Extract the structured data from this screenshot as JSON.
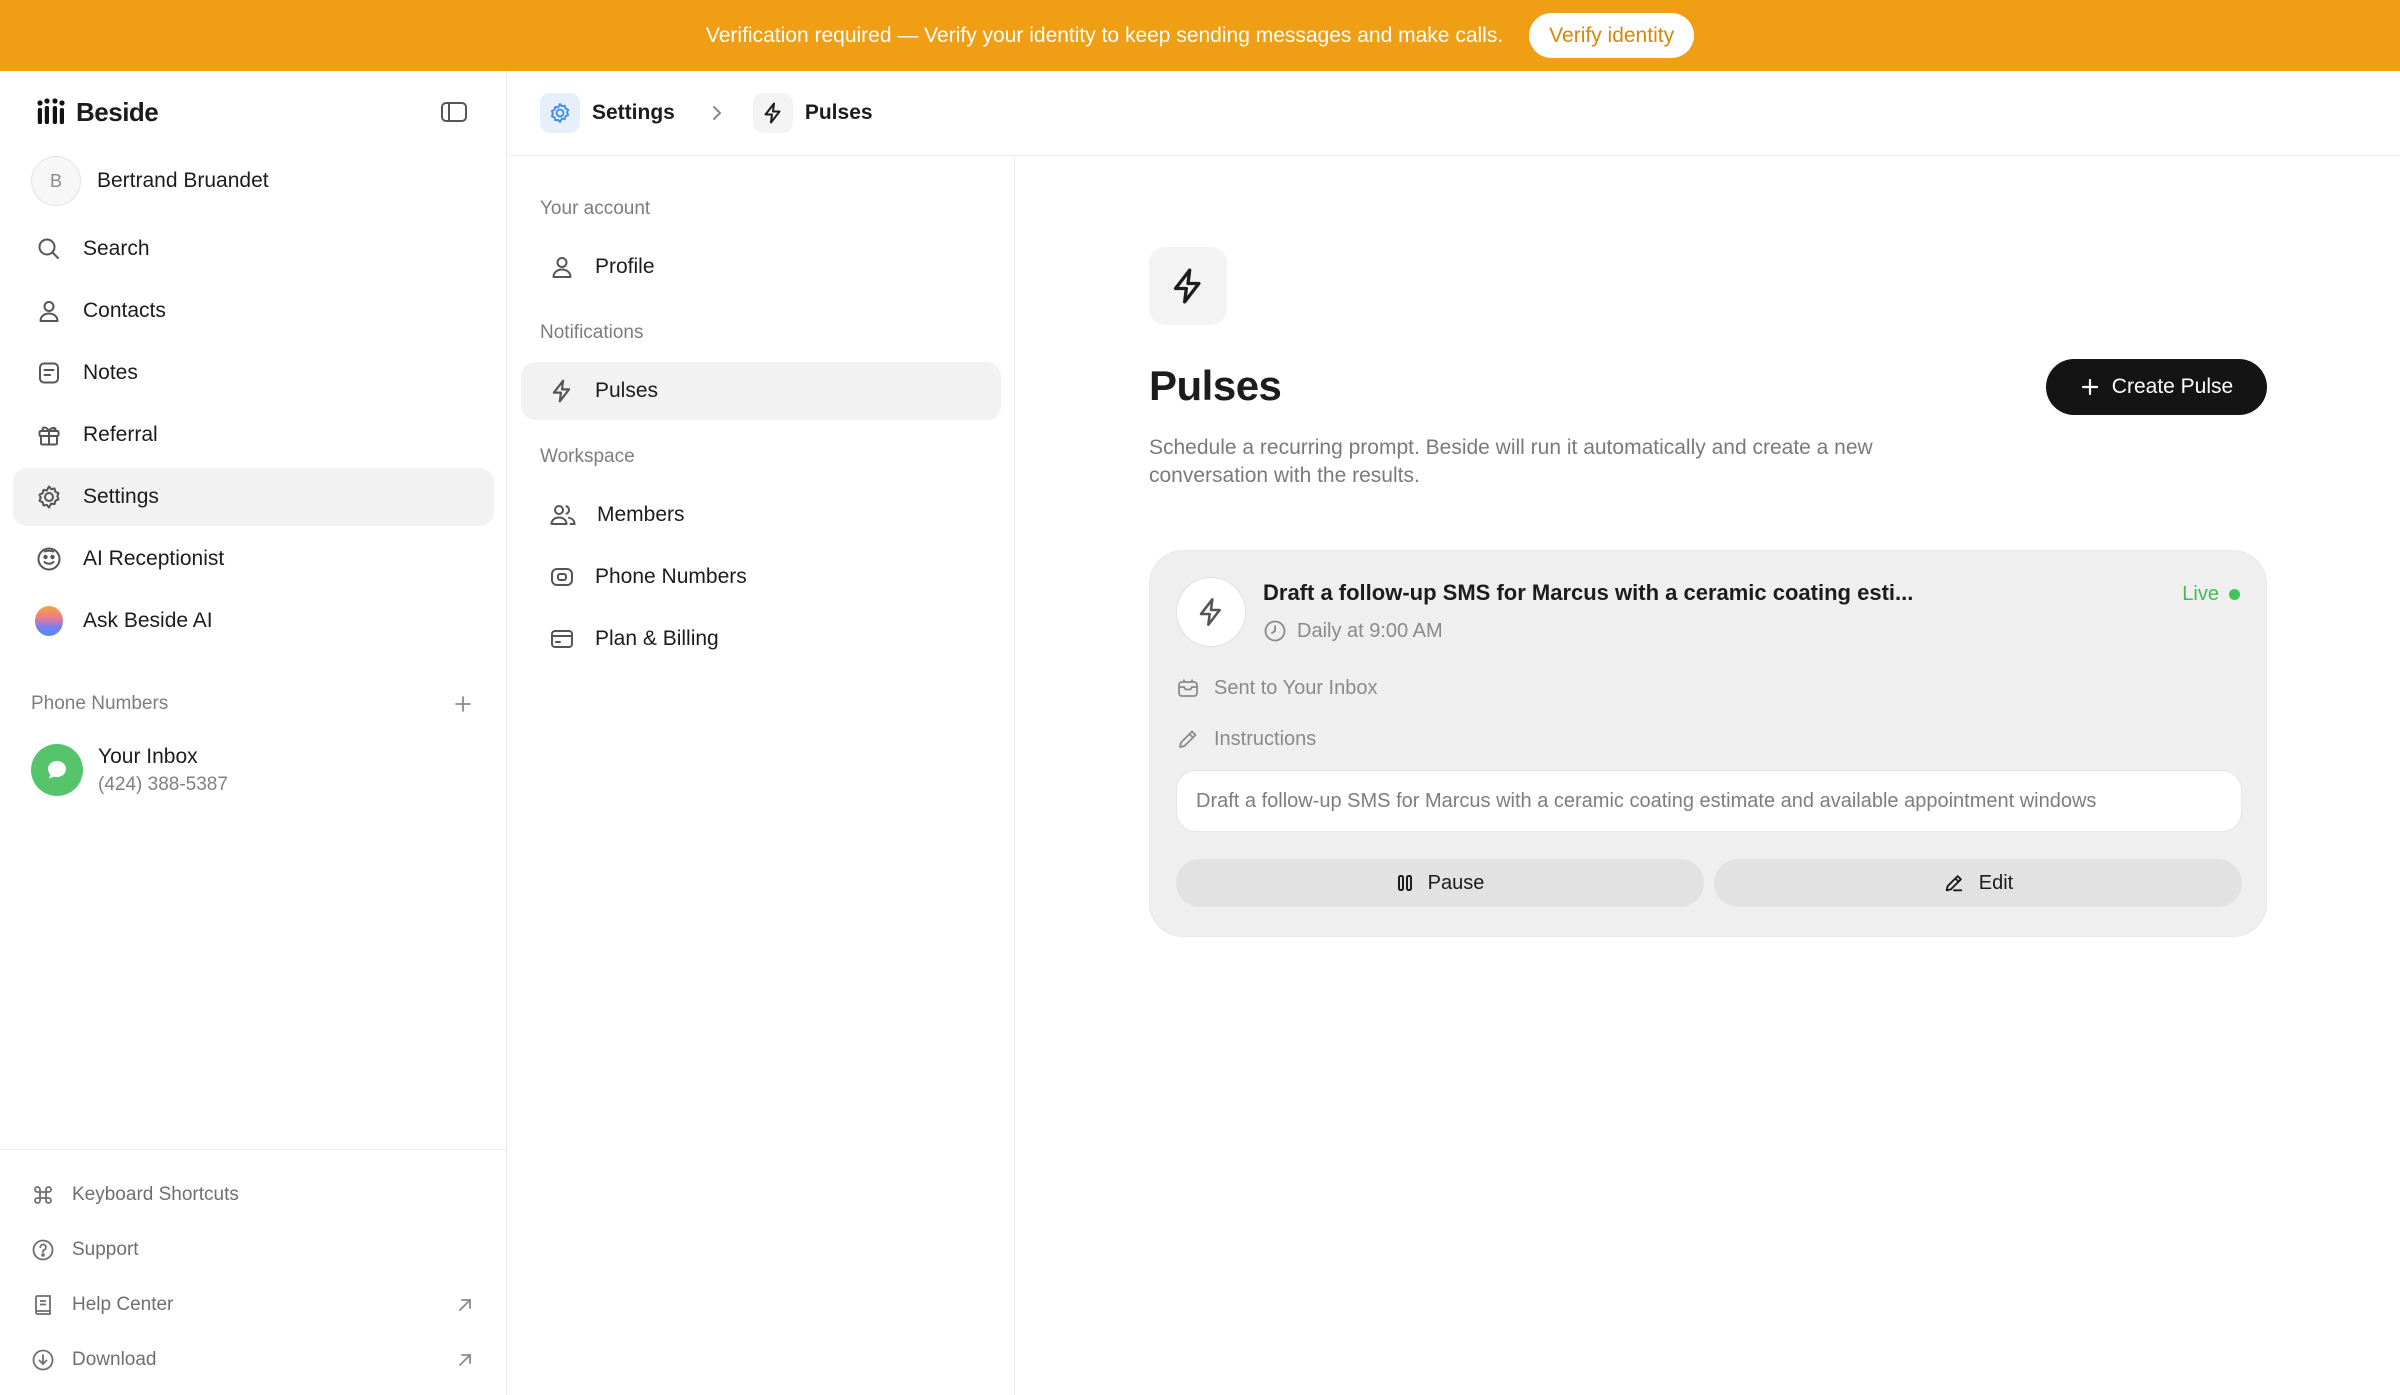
{
  "banner": {
    "text": "Verification required — Verify your identity to keep sending messages and make calls.",
    "button_label": "Verify identity",
    "color": "#f09e14"
  },
  "sidebar": {
    "brand": "Beside",
    "user": {
      "initial": "B",
      "name": "Bertrand Bruandet"
    },
    "items": [
      {
        "label": "Search",
        "icon": "search-icon"
      },
      {
        "label": "Contacts",
        "icon": "person-icon"
      },
      {
        "label": "Notes",
        "icon": "note-icon"
      },
      {
        "label": "Referral",
        "icon": "gift-icon"
      },
      {
        "label": "Settings",
        "icon": "gear-icon",
        "active": true
      },
      {
        "label": "AI Receptionist",
        "icon": "receptionist-icon"
      },
      {
        "label": "Ask Beside AI",
        "icon": "ai-orb-icon"
      }
    ],
    "phone_section_label": "Phone Numbers",
    "inbox": {
      "name": "Your Inbox",
      "number": "(424) 388-5387",
      "color": "#56c46b"
    },
    "footer": [
      {
        "label": "Keyboard Shortcuts",
        "icon": "command-icon"
      },
      {
        "label": "Support",
        "icon": "help-circle-icon"
      },
      {
        "label": "Help Center",
        "icon": "book-icon",
        "external": true
      },
      {
        "label": "Download",
        "icon": "download-icon",
        "external": true
      }
    ]
  },
  "header": {
    "breadcrumb": [
      {
        "label": "Settings",
        "icon": "gear-icon"
      },
      {
        "label": "Pulses",
        "icon": "lightning-icon"
      }
    ]
  },
  "settings_nav": {
    "sections": [
      {
        "label": "Your account",
        "items": [
          {
            "label": "Profile",
            "icon": "person-icon"
          }
        ]
      },
      {
        "label": "Notifications",
        "items": [
          {
            "label": "Pulses",
            "icon": "lightning-icon",
            "active": true
          }
        ]
      },
      {
        "label": "Workspace",
        "items": [
          {
            "label": "Members",
            "icon": "users-icon"
          },
          {
            "label": "Phone Numbers",
            "icon": "phone-box-icon"
          },
          {
            "label": "Plan & Billing",
            "icon": "card-icon"
          }
        ]
      }
    ]
  },
  "main": {
    "title": "Pulses",
    "description": "Schedule a recurring prompt. Beside will run it automatically and create a new conversation with the results.",
    "create_button": "Create Pulse",
    "pulse": {
      "title": "Draft a follow-up SMS for Marcus with a ceramic coating esti...",
      "schedule": "Daily at 9:00 AM",
      "status": "Live",
      "status_color": "#43c358",
      "destination": "Sent to Your Inbox",
      "instructions_label": "Instructions",
      "instructions": "Draft a follow-up SMS for Marcus with a ceramic coating estimate and available appointment windows",
      "pause_label": "Pause",
      "edit_label": "Edit"
    }
  }
}
